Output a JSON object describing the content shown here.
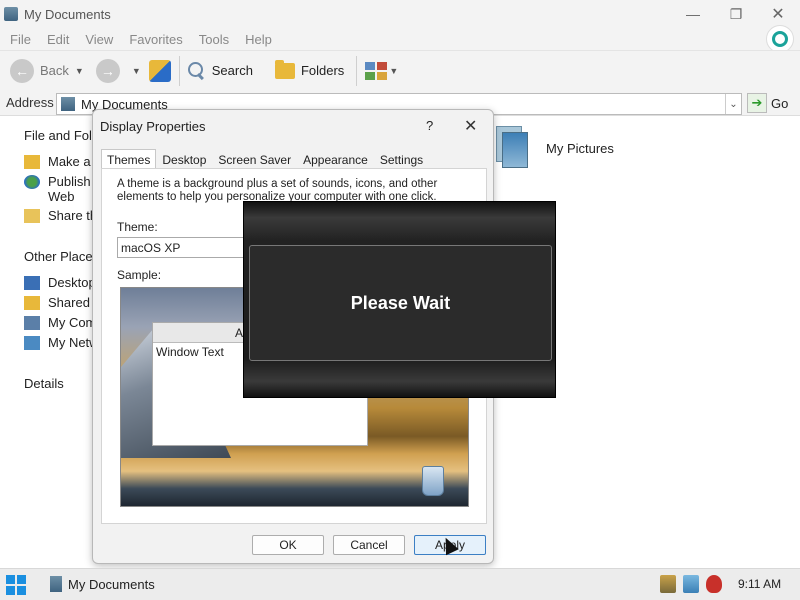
{
  "window": {
    "title": "My Documents"
  },
  "menu": [
    "File",
    "Edit",
    "View",
    "Favorites",
    "Tools",
    "Help"
  ],
  "toolbar": {
    "back_label": "Back",
    "search_label": "Search",
    "folders_label": "Folders"
  },
  "address": {
    "label": "Address",
    "value": "My Documents",
    "go_label": "Go"
  },
  "left_pane": {
    "file_folder_tasks": {
      "title": "File and Fold",
      "items": [
        "Make a n",
        "Publish\nWeb",
        "Share th"
      ]
    },
    "other_places": {
      "title": "Other Places",
      "items": [
        "Desktop",
        "Shared",
        "My Com",
        "My Netw"
      ]
    },
    "details_title": "Details"
  },
  "content": {
    "items": [
      {
        "label": "My Pictures",
        "icon": "pictures-folder-icon"
      }
    ]
  },
  "dialog": {
    "title": "Display Properties",
    "help": "?",
    "close": "✕",
    "tabs": [
      "Themes",
      "Desktop",
      "Screen Saver",
      "Appearance",
      "Settings"
    ],
    "active_tab": "Themes",
    "description": "A theme is a background plus a set of sounds, icons, and other elements to help you personalize your computer with one click.",
    "theme_label": "Theme:",
    "theme_value": "macOS XP",
    "sample_label": "Sample:",
    "sample_window_title": "Active Wi",
    "sample_window_text": "Window Text",
    "buttons": {
      "ok": "OK",
      "cancel": "Cancel",
      "apply": "Apply"
    }
  },
  "overlay": {
    "text": "Please Wait"
  },
  "taskbar": {
    "task_label": "My Documents",
    "clock": "9:11 AM"
  }
}
